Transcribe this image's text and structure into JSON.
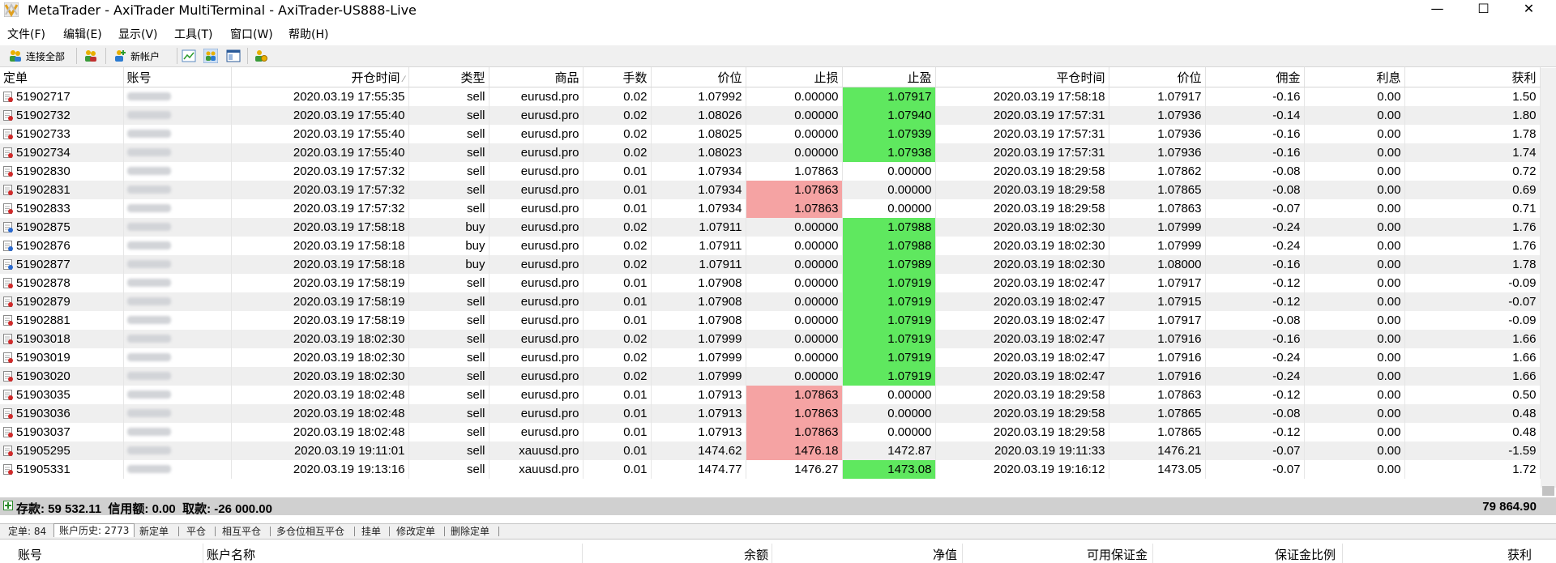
{
  "window": {
    "title": "MetaTrader - AxiTrader MultiTerminal - AxiTrader-US888-Live",
    "min_glyph": "—",
    "max_glyph": "☐",
    "close_glyph": "✕"
  },
  "menu": {
    "items": [
      "文件(F)",
      "编辑(E)",
      "显示(V)",
      "工具(T)",
      "窗口(W)",
      "帮助(H)"
    ]
  },
  "toolbar": {
    "connect_all": "连接全部",
    "new_account": "新帐户"
  },
  "table": {
    "columns": [
      "定单",
      "账号",
      "开仓时间",
      "类型",
      "商品",
      "手数",
      "价位",
      "止损",
      "止盈",
      "平仓时间",
      "价位",
      "佣金",
      "利息",
      "获利"
    ],
    "sort_indicator": "⁄",
    "rows": [
      {
        "order": "51902717",
        "open": "2020.03.19 17:55:35",
        "type": "sell",
        "symbol": "eurusd.pro",
        "lots": "0.02",
        "price": "1.07992",
        "sl": "0.00000",
        "tp": "1.07917",
        "close": "2020.03.19 17:58:18",
        "cprice": "1.07917",
        "comm": "-0.16",
        "swap": "0.00",
        "profit": "1.50",
        "hl": "tp"
      },
      {
        "order": "51902732",
        "open": "2020.03.19 17:55:40",
        "type": "sell",
        "symbol": "eurusd.pro",
        "lots": "0.02",
        "price": "1.08026",
        "sl": "0.00000",
        "tp": "1.07940",
        "close": "2020.03.19 17:57:31",
        "cprice": "1.07936",
        "comm": "-0.14",
        "swap": "0.00",
        "profit": "1.80",
        "hl": "tp"
      },
      {
        "order": "51902733",
        "open": "2020.03.19 17:55:40",
        "type": "sell",
        "symbol": "eurusd.pro",
        "lots": "0.02",
        "price": "1.08025",
        "sl": "0.00000",
        "tp": "1.07939",
        "close": "2020.03.19 17:57:31",
        "cprice": "1.07936",
        "comm": "-0.16",
        "swap": "0.00",
        "profit": "1.78",
        "hl": "tp"
      },
      {
        "order": "51902734",
        "open": "2020.03.19 17:55:40",
        "type": "sell",
        "symbol": "eurusd.pro",
        "lots": "0.02",
        "price": "1.08023",
        "sl": "0.00000",
        "tp": "1.07938",
        "close": "2020.03.19 17:57:31",
        "cprice": "1.07936",
        "comm": "-0.16",
        "swap": "0.00",
        "profit": "1.74",
        "hl": "tp"
      },
      {
        "order": "51902830",
        "open": "2020.03.19 17:57:32",
        "type": "sell",
        "symbol": "eurusd.pro",
        "lots": "0.01",
        "price": "1.07934",
        "sl": "1.07863",
        "tp": "0.00000",
        "close": "2020.03.19 18:29:58",
        "cprice": "1.07862",
        "comm": "-0.08",
        "swap": "0.00",
        "profit": "0.72",
        "hl": ""
      },
      {
        "order": "51902831",
        "open": "2020.03.19 17:57:32",
        "type": "sell",
        "symbol": "eurusd.pro",
        "lots": "0.01",
        "price": "1.07934",
        "sl": "1.07863",
        "tp": "0.00000",
        "close": "2020.03.19 18:29:58",
        "cprice": "1.07865",
        "comm": "-0.08",
        "swap": "0.00",
        "profit": "0.69",
        "hl": "sl"
      },
      {
        "order": "51902833",
        "open": "2020.03.19 17:57:32",
        "type": "sell",
        "symbol": "eurusd.pro",
        "lots": "0.01",
        "price": "1.07934",
        "sl": "1.07863",
        "tp": "0.00000",
        "close": "2020.03.19 18:29:58",
        "cprice": "1.07863",
        "comm": "-0.07",
        "swap": "0.00",
        "profit": "0.71",
        "hl": "sl"
      },
      {
        "order": "51902875",
        "open": "2020.03.19 17:58:18",
        "type": "buy",
        "symbol": "eurusd.pro",
        "lots": "0.02",
        "price": "1.07911",
        "sl": "0.00000",
        "tp": "1.07988",
        "close": "2020.03.19 18:02:30",
        "cprice": "1.07999",
        "comm": "-0.24",
        "swap": "0.00",
        "profit": "1.76",
        "hl": "tp"
      },
      {
        "order": "51902876",
        "open": "2020.03.19 17:58:18",
        "type": "buy",
        "symbol": "eurusd.pro",
        "lots": "0.02",
        "price": "1.07911",
        "sl": "0.00000",
        "tp": "1.07988",
        "close": "2020.03.19 18:02:30",
        "cprice": "1.07999",
        "comm": "-0.24",
        "swap": "0.00",
        "profit": "1.76",
        "hl": "tp"
      },
      {
        "order": "51902877",
        "open": "2020.03.19 17:58:18",
        "type": "buy",
        "symbol": "eurusd.pro",
        "lots": "0.02",
        "price": "1.07911",
        "sl": "0.00000",
        "tp": "1.07989",
        "close": "2020.03.19 18:02:30",
        "cprice": "1.08000",
        "comm": "-0.16",
        "swap": "0.00",
        "profit": "1.78",
        "hl": "tp"
      },
      {
        "order": "51902878",
        "open": "2020.03.19 17:58:19",
        "type": "sell",
        "symbol": "eurusd.pro",
        "lots": "0.01",
        "price": "1.07908",
        "sl": "0.00000",
        "tp": "1.07919",
        "close": "2020.03.19 18:02:47",
        "cprice": "1.07917",
        "comm": "-0.12",
        "swap": "0.00",
        "profit": "-0.09",
        "hl": "tp"
      },
      {
        "order": "51902879",
        "open": "2020.03.19 17:58:19",
        "type": "sell",
        "symbol": "eurusd.pro",
        "lots": "0.01",
        "price": "1.07908",
        "sl": "0.00000",
        "tp": "1.07919",
        "close": "2020.03.19 18:02:47",
        "cprice": "1.07915",
        "comm": "-0.12",
        "swap": "0.00",
        "profit": "-0.07",
        "hl": "tp"
      },
      {
        "order": "51902881",
        "open": "2020.03.19 17:58:19",
        "type": "sell",
        "symbol": "eurusd.pro",
        "lots": "0.01",
        "price": "1.07908",
        "sl": "0.00000",
        "tp": "1.07919",
        "close": "2020.03.19 18:02:47",
        "cprice": "1.07917",
        "comm": "-0.08",
        "swap": "0.00",
        "profit": "-0.09",
        "hl": "tp"
      },
      {
        "order": "51903018",
        "open": "2020.03.19 18:02:30",
        "type": "sell",
        "symbol": "eurusd.pro",
        "lots": "0.02",
        "price": "1.07999",
        "sl": "0.00000",
        "tp": "1.07919",
        "close": "2020.03.19 18:02:47",
        "cprice": "1.07916",
        "comm": "-0.16",
        "swap": "0.00",
        "profit": "1.66",
        "hl": "tp"
      },
      {
        "order": "51903019",
        "open": "2020.03.19 18:02:30",
        "type": "sell",
        "symbol": "eurusd.pro",
        "lots": "0.02",
        "price": "1.07999",
        "sl": "0.00000",
        "tp": "1.07919",
        "close": "2020.03.19 18:02:47",
        "cprice": "1.07916",
        "comm": "-0.24",
        "swap": "0.00",
        "profit": "1.66",
        "hl": "tp"
      },
      {
        "order": "51903020",
        "open": "2020.03.19 18:02:30",
        "type": "sell",
        "symbol": "eurusd.pro",
        "lots": "0.02",
        "price": "1.07999",
        "sl": "0.00000",
        "tp": "1.07919",
        "close": "2020.03.19 18:02:47",
        "cprice": "1.07916",
        "comm": "-0.24",
        "swap": "0.00",
        "profit": "1.66",
        "hl": "tp"
      },
      {
        "order": "51903035",
        "open": "2020.03.19 18:02:48",
        "type": "sell",
        "symbol": "eurusd.pro",
        "lots": "0.01",
        "price": "1.07913",
        "sl": "1.07863",
        "tp": "0.00000",
        "close": "2020.03.19 18:29:58",
        "cprice": "1.07863",
        "comm": "-0.12",
        "swap": "0.00",
        "profit": "0.50",
        "hl": "sl"
      },
      {
        "order": "51903036",
        "open": "2020.03.19 18:02:48",
        "type": "sell",
        "symbol": "eurusd.pro",
        "lots": "0.01",
        "price": "1.07913",
        "sl": "1.07863",
        "tp": "0.00000",
        "close": "2020.03.19 18:29:58",
        "cprice": "1.07865",
        "comm": "-0.08",
        "swap": "0.00",
        "profit": "0.48",
        "hl": "sl"
      },
      {
        "order": "51903037",
        "open": "2020.03.19 18:02:48",
        "type": "sell",
        "symbol": "eurusd.pro",
        "lots": "0.01",
        "price": "1.07913",
        "sl": "1.07863",
        "tp": "0.00000",
        "close": "2020.03.19 18:29:58",
        "cprice": "1.07865",
        "comm": "-0.12",
        "swap": "0.00",
        "profit": "0.48",
        "hl": "sl"
      },
      {
        "order": "51905295",
        "open": "2020.03.19 19:11:01",
        "type": "sell",
        "symbol": "xauusd.pro",
        "lots": "0.01",
        "price": "1474.62",
        "sl": "1476.18",
        "tp": "1472.87",
        "close": "2020.03.19 19:11:33",
        "cprice": "1476.21",
        "comm": "-0.07",
        "swap": "0.00",
        "profit": "-1.59",
        "hl": "sl"
      },
      {
        "order": "51905331",
        "open": "2020.03.19 19:13:16",
        "type": "sell",
        "symbol": "xauusd.pro",
        "lots": "0.01",
        "price": "1474.77",
        "sl": "1476.27",
        "tp": "1473.08",
        "close": "2020.03.19 19:16:12",
        "cprice": "1473.05",
        "comm": "-0.07",
        "swap": "0.00",
        "profit": "1.72",
        "hl": "tp"
      }
    ]
  },
  "totals": {
    "summary": "存款: 59 532.11  信用额: 0.00  取款: -26 000.00",
    "profit": "79 864.90"
  },
  "tabs": {
    "items": [
      "定单: 84",
      "账户历史: 2773",
      "新定单",
      "平仓",
      "相互平仓",
      "多仓位相互平仓",
      "挂单",
      "修改定单",
      "删除定单"
    ],
    "active_index": 1
  },
  "bottom_table": {
    "columns": [
      "账号",
      "账户名称",
      "余额",
      "净值",
      "可用保证金",
      "保证金比例",
      "获利"
    ]
  },
  "colors": {
    "tp_highlight": "#5fe85f",
    "sl_highlight": "#f5a3a3",
    "totals_bar": "#d0d0d0"
  }
}
